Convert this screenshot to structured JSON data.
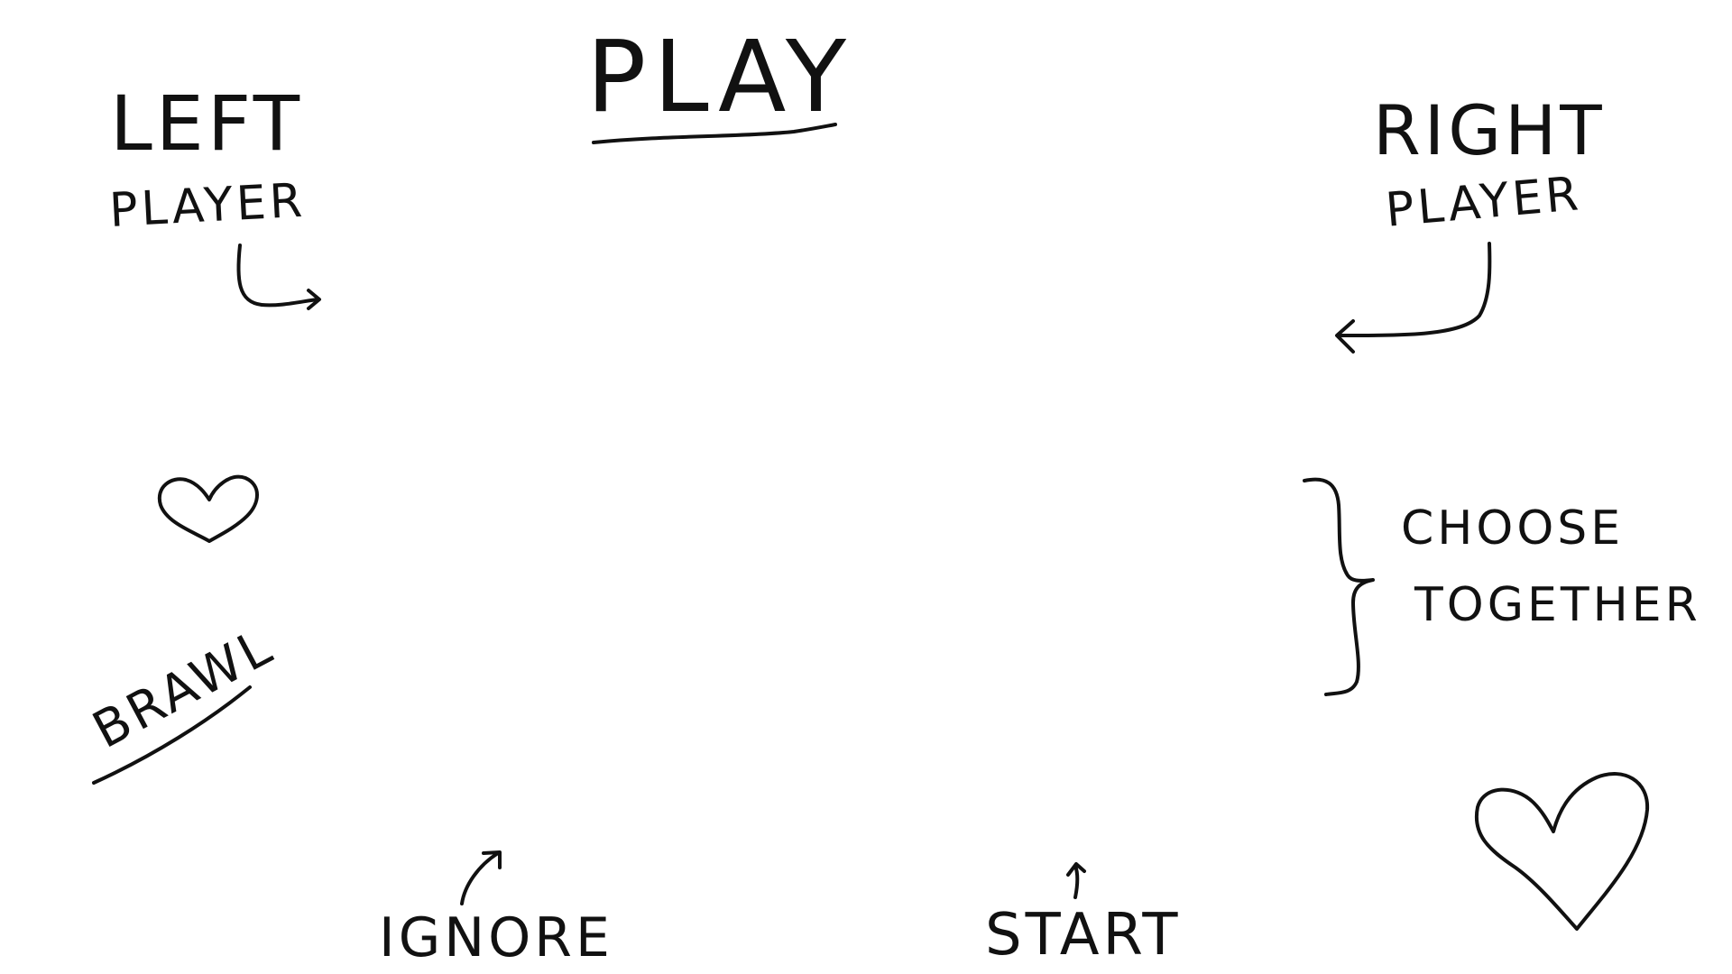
{
  "labels": {
    "play": "PLAY",
    "left": "LEFT",
    "left_player": "PLAYER",
    "right": "RIGHT",
    "right_player": "PLAYER",
    "brawl": "BRAWL",
    "choose": "CHOOSE",
    "together": "TOGETHER",
    "ignore": "IGNORE",
    "start": "START"
  },
  "icons": {
    "small_heart": "heart-icon",
    "large_heart": "heart-icon",
    "left_player_arrow": "curved-arrow-right-icon",
    "right_player_arrow": "curved-arrow-left-icon",
    "ignore_arrow": "arrow-up-right-icon",
    "start_arrow": "arrow-up-icon",
    "choose_brace": "curly-brace-icon"
  },
  "colors": {
    "ink": "#111111",
    "background": "#ffffff"
  }
}
